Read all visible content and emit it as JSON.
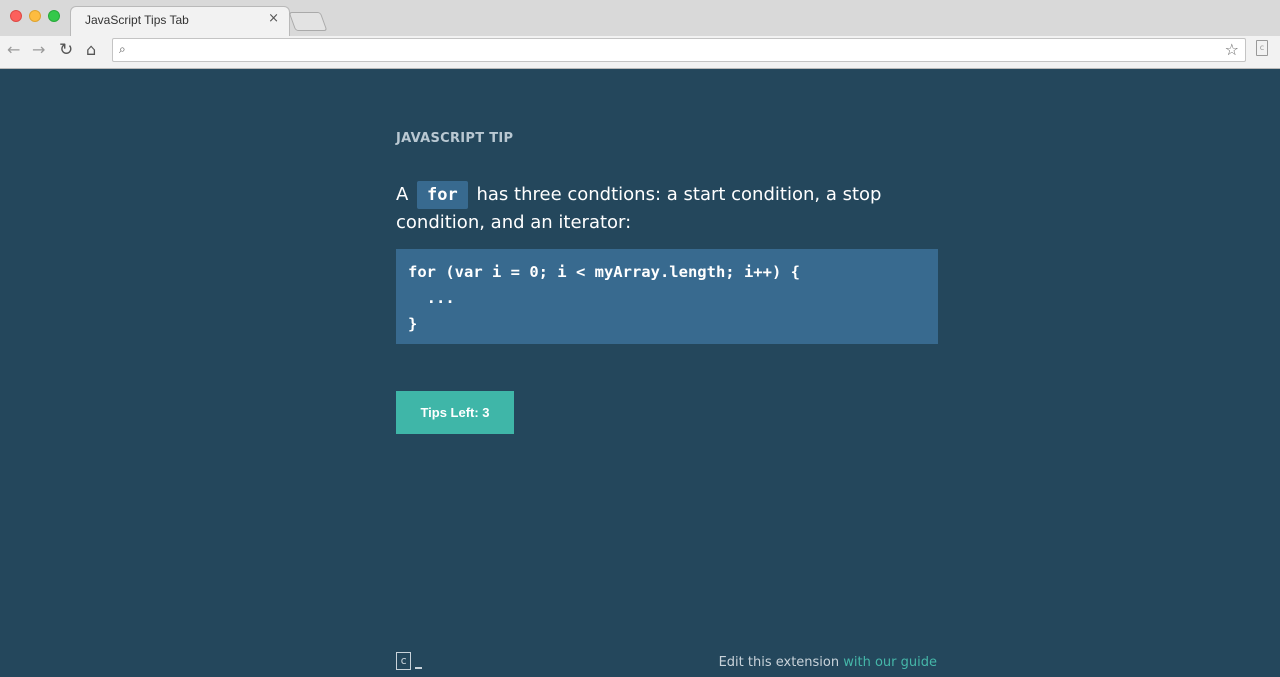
{
  "browser": {
    "tab_title": "JavaScript Tips Tab",
    "tab_close": "×",
    "address": ""
  },
  "icons": {
    "back": "back-arrow-icon",
    "forward": "forward-arrow-icon",
    "reload": "reload-icon",
    "home": "home-icon",
    "search": "search-icon",
    "bookmark": "star-icon",
    "extension": "extension-icon",
    "logo": "codecademy-logo-icon"
  },
  "tip": {
    "eyebrow": "JAVASCRIPT TIP",
    "text_before": "A ",
    "keyword": "for",
    "text_after": " has three condtions: a start condition, a stop condition, and an iterator:",
    "code_lines": [
      "for (var i = 0; i < myArray.length; i++) {",
      "  ...",
      "}"
    ]
  },
  "button": {
    "label": "Tips Left: 3"
  },
  "footer": {
    "logo_letter": "c",
    "text": "Edit this extension ",
    "link": "with our guide"
  },
  "colors": {
    "background": "#24475c",
    "code_bg": "#386a8f",
    "accent": "#3fb6a8"
  }
}
